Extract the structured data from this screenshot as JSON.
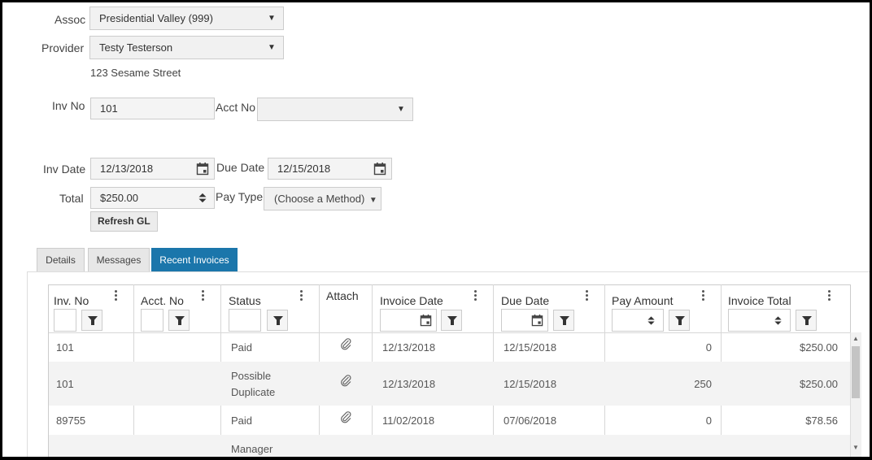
{
  "form": {
    "assoc_label": "Assoc",
    "assoc_value": "Presidential Valley (999)",
    "provider_label": "Provider",
    "provider_value": "Testy Testerson",
    "provider_address": "123 Sesame Street",
    "inv_no_label": "Inv No",
    "inv_no_value": "101",
    "acct_no_label": "Acct No",
    "acct_no_value": "",
    "inv_date_label": "Inv Date",
    "inv_date_value": "12/13/2018",
    "due_date_label": "Due Date",
    "due_date_value": "12/15/2018",
    "total_label": "Total",
    "total_value": "$250.00",
    "pay_type_label": "Pay Type",
    "pay_type_value": "(Choose a Method)",
    "refresh_gl_label": "Refresh GL"
  },
  "tabs": [
    {
      "label": "Details",
      "active": false
    },
    {
      "label": "Messages",
      "active": false
    },
    {
      "label": "Recent Invoices",
      "active": true
    }
  ],
  "grid": {
    "columns": [
      "Inv. No",
      "Acct. No",
      "Status",
      "Attach",
      "Invoice Date",
      "Due Date",
      "Pay Amount",
      "Invoice Total"
    ],
    "rows": [
      {
        "inv_no": "101",
        "acct_no": "",
        "status": "Paid",
        "status2": "",
        "attach": true,
        "invoice_date": "12/13/2018",
        "due_date": "12/15/2018",
        "pay_amount": "0",
        "invoice_total": "$250.00"
      },
      {
        "inv_no": "101",
        "acct_no": "",
        "status": "Possible",
        "status2": "Duplicate",
        "attach": true,
        "invoice_date": "12/13/2018",
        "due_date": "12/15/2018",
        "pay_amount": "250",
        "invoice_total": "$250.00"
      },
      {
        "inv_no": "89755",
        "acct_no": "",
        "status": "Paid",
        "status2": "",
        "attach": true,
        "invoice_date": "11/02/2018",
        "due_date": "07/06/2018",
        "pay_amount": "0",
        "invoice_total": "$78.56"
      },
      {
        "inv_no": "",
        "acct_no": "",
        "status": "Manager",
        "status2": "",
        "attach": false,
        "invoice_date": "",
        "due_date": "",
        "pay_amount": "",
        "invoice_total": ""
      }
    ]
  },
  "colors": {
    "active_tab": "#1b76ab",
    "alt_row": "#f3f3f3"
  }
}
